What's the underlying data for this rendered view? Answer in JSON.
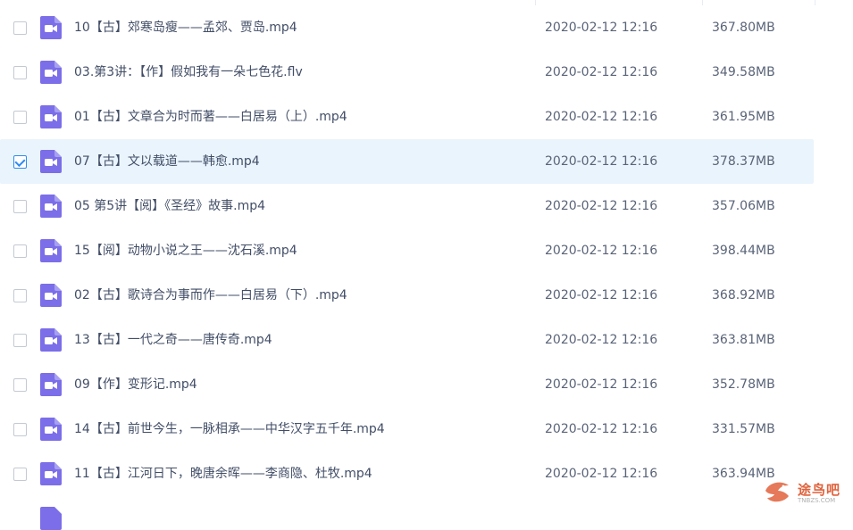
{
  "colors": {
    "accent": "#2b8cf5",
    "video_icon": "#7b6ee8",
    "selected_row_bg": "#eaf4fc"
  },
  "files": [
    {
      "name": "10【古】郊寒岛瘦——孟郊、贾岛.mp4",
      "date": "2020-02-12 12:16",
      "size": "367.80MB",
      "checked": false
    },
    {
      "name": "03.第3讲：【作】假如我有一朵七色花.flv",
      "date": "2020-02-12 12:16",
      "size": "349.58MB",
      "checked": false
    },
    {
      "name": "01【古】文章合为时而著——白居易（上）.mp4",
      "date": "2020-02-12 12:16",
      "size": "361.95MB",
      "checked": false
    },
    {
      "name": "07【古】文以载道——韩愈.mp4",
      "date": "2020-02-12 12:16",
      "size": "378.37MB",
      "checked": true
    },
    {
      "name": "05 第5讲【阅】《圣经》故事.mp4",
      "date": "2020-02-12 12:16",
      "size": "357.06MB",
      "checked": false
    },
    {
      "name": "15【阅】动物小说之王——沈石溪.mp4",
      "date": "2020-02-12 12:16",
      "size": "398.44MB",
      "checked": false
    },
    {
      "name": "02【古】歌诗合为事而作——白居易（下）.mp4",
      "date": "2020-02-12 12:16",
      "size": "368.92MB",
      "checked": false
    },
    {
      "name": "13【古】一代之奇——唐传奇.mp4",
      "date": "2020-02-12 12:16",
      "size": "363.81MB",
      "checked": false
    },
    {
      "name": "09【作】变形记.mp4",
      "date": "2020-02-12 12:16",
      "size": "352.78MB",
      "checked": false
    },
    {
      "name": "14【古】前世今生，一脉相承——中华汉字五千年.mp4",
      "date": "2020-02-12 12:16",
      "size": "331.57MB",
      "checked": false
    },
    {
      "name": "11【古】江河日下，晚唐余晖——李商隐、杜牧.mp4",
      "date": "2020-02-12 12:16",
      "size": "363.94MB",
      "checked": false
    }
  ],
  "icons": {
    "file_type": "video-file-icon",
    "checkbox_checked": "check-icon"
  },
  "watermark": {
    "text_cn": "途鸟吧",
    "text_en": "TNBZS.COM"
  }
}
